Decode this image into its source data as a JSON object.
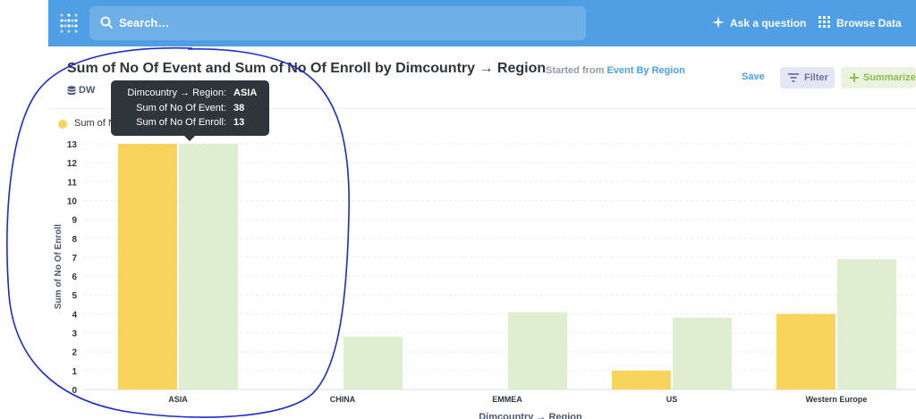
{
  "navbar": {
    "search_placeholder": "Search…",
    "ask_question": "Ask a question",
    "browse_data": "Browse Data"
  },
  "question": {
    "title": "Sum of No Of Event and Sum of No Of Enroll by Dimcountry → Region",
    "started_from_prefix": "Started from",
    "started_from_link": "Event By Region",
    "database": "DW"
  },
  "actions": {
    "save": "Save",
    "filter": "Filter",
    "summarize": "Summarize"
  },
  "colors": {
    "navbar": "#509ee3",
    "event_series": "#f9d45c",
    "enroll_series": "#dfeed0",
    "annotation": "#1a2cc8"
  },
  "legend": {
    "item1": "Sum of No Of Event"
  },
  "tooltip": {
    "rows": [
      {
        "key": "Dimcountry → Region:",
        "value": "ASIA"
      },
      {
        "key": "Sum of No Of Event:",
        "value": "38"
      },
      {
        "key": "Sum of No Of Enroll:",
        "value": "13"
      }
    ]
  },
  "chart_data": {
    "type": "bar",
    "categories": [
      "ASIA",
      "CHINA",
      "EMMEA",
      "US",
      "Western Europe"
    ],
    "series": [
      {
        "name": "Sum of No Of Event",
        "values": [
          13,
          0,
          0,
          1,
          4
        ]
      },
      {
        "name": "Sum of No Of Enroll",
        "values": [
          13,
          2.8,
          4.1,
          3.8,
          6.9
        ]
      }
    ],
    "ylabel": "Sum of No Of Enroll",
    "xlabel": "Dimcountry → Region",
    "ylim": [
      0,
      13
    ],
    "yticks": [
      0,
      1,
      2,
      3,
      4,
      5,
      6,
      7,
      8,
      9,
      10,
      11,
      12,
      13
    ],
    "grid": true
  }
}
